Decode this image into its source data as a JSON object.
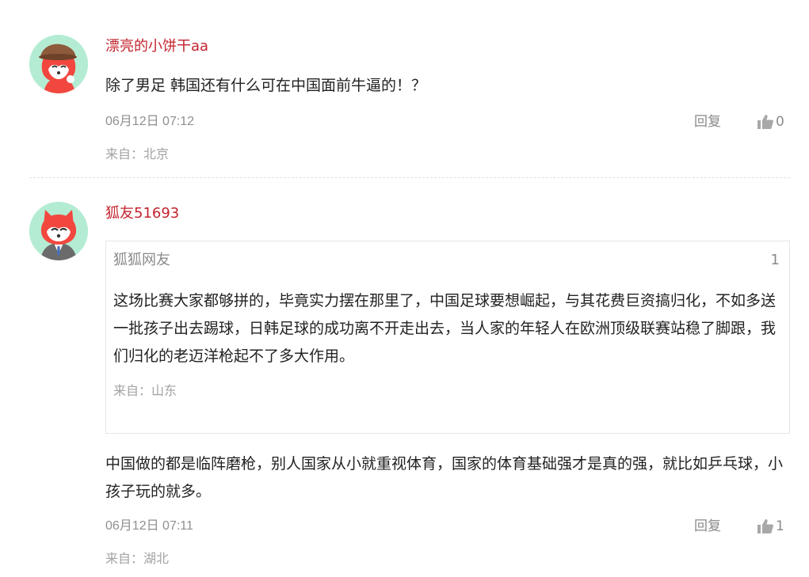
{
  "comments": [
    {
      "username": "漂亮的小饼干aa",
      "text": "除了男足 韩国还有什么可在中国面前牛逼的！？",
      "time": "06月12日 07:12",
      "reply_label": "回复",
      "like_count": "0",
      "location": "来自：北京"
    },
    {
      "username": "狐友51693",
      "quote": {
        "username": "狐狐网友",
        "floor": "1",
        "text": "这场比赛大家都够拼的，毕竟实力摆在那里了，中国足球要想崛起，与其花费巨资搞归化，不如多送一批孩子出去踢球，日韩足球的成功离不开走出去，当人家的年轻人在欧洲顶级联赛站稳了脚跟，我们归化的老迈洋枪起不了多大作用。",
        "location": "来自：山东"
      },
      "text": "中国做的都是临阵磨枪，别人国家从小就重视体育，国家的体育基础强才是真的强，就比如乒乓球，小孩子玩的就多。",
      "time": "06月12日 07:11",
      "reply_label": "回复",
      "like_count": "1",
      "location": "来自：湖北"
    }
  ],
  "icons": {
    "like": "thumbs-up-icon",
    "avatar": "fox-avatar-icon"
  },
  "colors": {
    "username": "#c4232d",
    "avatar_bg": "#b4ecd3",
    "fox": "#f2473f",
    "meta": "#8f8f8f"
  }
}
